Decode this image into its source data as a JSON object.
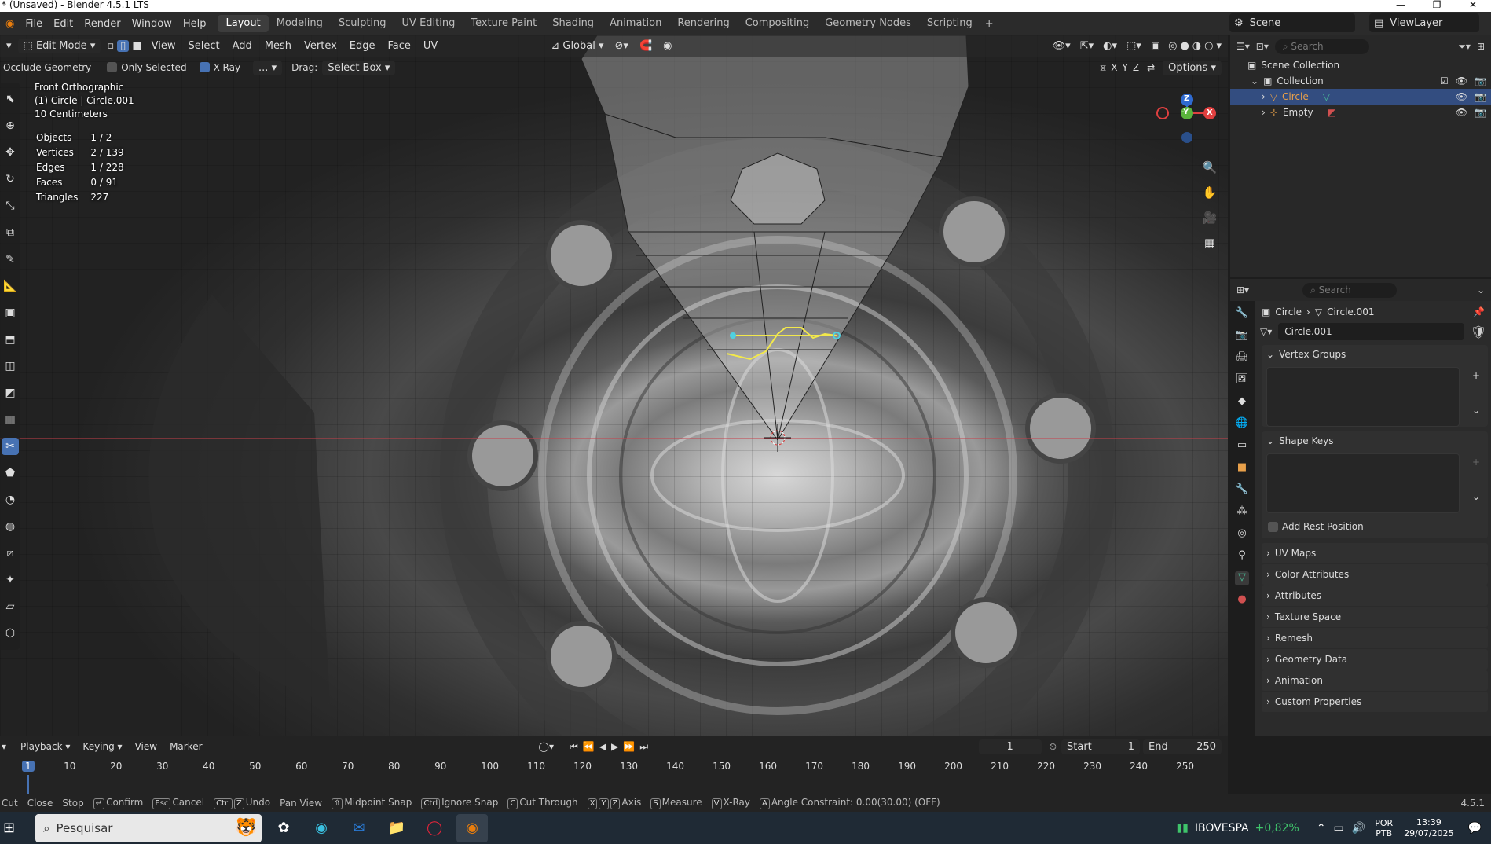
{
  "window": {
    "title": "* (Unsaved) - Blender 4.5.1 LTS",
    "min": "—",
    "max": "❐",
    "close": "✕"
  },
  "menu": [
    "File",
    "Edit",
    "Render",
    "Window",
    "Help"
  ],
  "workspaces": [
    "Layout",
    "Modeling",
    "Sculpting",
    "UV Editing",
    "Texture Paint",
    "Shading",
    "Animation",
    "Rendering",
    "Compositing",
    "Geometry Nodes",
    "Scripting"
  ],
  "workspace_plus": "+",
  "scene": {
    "scene_name": "Scene",
    "view_layer": "ViewLayer"
  },
  "viewport_header": {
    "mode": "Edit Mode",
    "menus": [
      "View",
      "Select",
      "Add",
      "Mesh",
      "Vertex",
      "Edge",
      "Face",
      "UV"
    ],
    "orientation": "Global"
  },
  "tool_settings": {
    "occlude": "Occlude Geometry",
    "only_selected": "Only Selected",
    "xray": "X-Ray",
    "ellipsis": "...",
    "drag_label": "Drag:",
    "drag_value": "Select Box",
    "axes": [
      "X",
      "Y",
      "Z"
    ],
    "options": "Options"
  },
  "overlay_info": {
    "view": "Front Orthographic",
    "object": "(1) Circle | Circle.001",
    "scale": "10 Centimeters"
  },
  "stats": [
    {
      "label": "Objects",
      "value": "1 / 2"
    },
    {
      "label": "Vertices",
      "value": "2 / 139"
    },
    {
      "label": "Edges",
      "value": "1 / 228"
    },
    {
      "label": "Faces",
      "value": "0 / 91"
    },
    {
      "label": "Triangles",
      "value": "227"
    }
  ],
  "gizmo": {
    "z": "Z",
    "y": "-Y",
    "x": "X"
  },
  "outliner": {
    "search_placeholder": "Search",
    "scene_collection": "Scene Collection",
    "collection": "Collection",
    "items": [
      {
        "name": "Circle",
        "selected": true
      },
      {
        "name": "Empty",
        "selected": false
      }
    ]
  },
  "properties": {
    "search_placeholder": "Search",
    "breadcrumb_object": "Circle",
    "breadcrumb_mesh": "Circle.001",
    "mesh_name": "Circle.001",
    "vertex_groups": "Vertex Groups",
    "shape_keys": "Shape Keys",
    "add_rest_position": "Add Rest Position",
    "panels": [
      "UV Maps",
      "Color Attributes",
      "Attributes",
      "Texture Space",
      "Remesh",
      "Geometry Data",
      "Animation",
      "Custom Properties"
    ]
  },
  "timeline": {
    "menus": [
      "Playback",
      "Keying",
      "View",
      "Marker"
    ],
    "current_frame": "1",
    "start_label": "Start",
    "start": "1",
    "end_label": "End",
    "end": "250",
    "ticks": [
      "1",
      "10",
      "20",
      "30",
      "40",
      "50",
      "60",
      "70",
      "80",
      "90",
      "100",
      "110",
      "120",
      "130",
      "140",
      "150",
      "160",
      "170",
      "180",
      "190",
      "200",
      "210",
      "220",
      "230",
      "240",
      "250"
    ]
  },
  "statusbar": {
    "items": [
      {
        "key": "",
        "label": "Cut"
      },
      {
        "key": "",
        "label": "Close"
      },
      {
        "key": "",
        "label": "Stop"
      },
      {
        "key": "↵",
        "label": "Confirm"
      },
      {
        "key": "Esc",
        "label": "Cancel"
      },
      {
        "key": "Ctrl Z",
        "label": "Undo"
      },
      {
        "key": "",
        "label": "Pan View"
      },
      {
        "key": "⇧",
        "label": "Midpoint Snap"
      },
      {
        "key": "Ctrl",
        "label": "Ignore Snap"
      },
      {
        "key": "C",
        "label": "Cut Through"
      },
      {
        "key": "X Y Z",
        "label": "Axis"
      },
      {
        "key": "S",
        "label": "Measure"
      },
      {
        "key": "V",
        "label": "X-Ray"
      },
      {
        "key": "A",
        "label": "Angle Constraint: 0.00(30.00) (OFF)"
      }
    ],
    "version": "4.5.1"
  },
  "taskbar": {
    "search": "Pesquisar",
    "stock_name": "IBOVESPA",
    "stock_change": "+0,82%",
    "lang": "POR",
    "lang2": "PTB",
    "time": "13:39",
    "date": "29/07/2025",
    "colors": {
      "stock_up": "#3fc46b",
      "accent": "#4772b3"
    }
  }
}
